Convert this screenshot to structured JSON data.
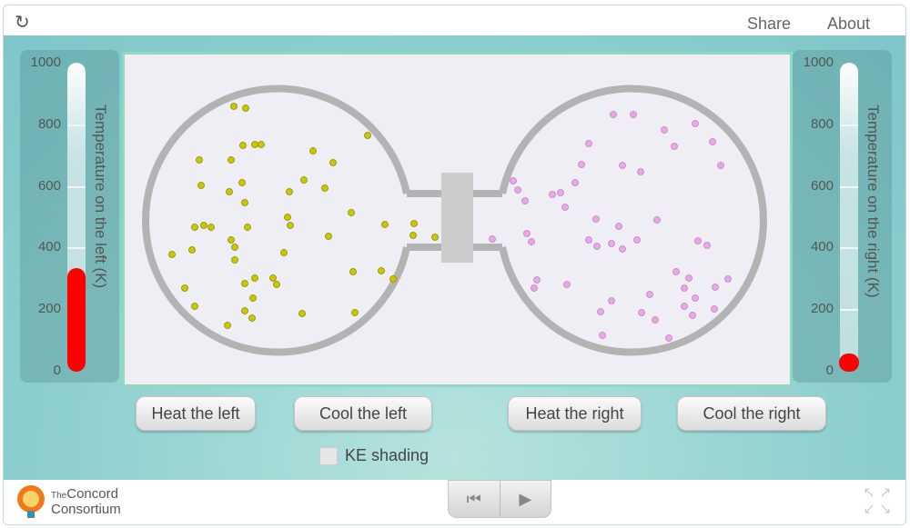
{
  "topbar": {
    "reload_icon": "reload-icon",
    "share": "Share",
    "about": "About"
  },
  "thermometers": {
    "ticks": [
      "1000",
      "800",
      "600",
      "400",
      "200",
      "0"
    ],
    "left": {
      "label": "Temperature on the left (K)",
      "value_k": 336,
      "max_k": 1000,
      "fill_color": "#ff0000"
    },
    "right": {
      "label": "Temperature on the right (K)",
      "value_k": 10,
      "max_k": 1000,
      "fill_color": "#ff0000"
    }
  },
  "simulation": {
    "left_particle_color": "#c8c800",
    "right_particle_color": "#e8a8e8",
    "wall_color": "#b3b3b3"
  },
  "buttons": {
    "heat_left": "Heat the left",
    "cool_left": "Cool the left",
    "heat_right": "Heat the right",
    "cool_right": "Cool the right"
  },
  "ke_shading": {
    "label": "KE shading",
    "checked": false
  },
  "footer": {
    "logo_line1_small": "The",
    "logo_line1": "Concord",
    "logo_line2": "Consortium",
    "rewind_icon": "rewind-icon",
    "play_icon": "play-icon",
    "fullscreen_icon": "fullscreen-icon"
  }
}
